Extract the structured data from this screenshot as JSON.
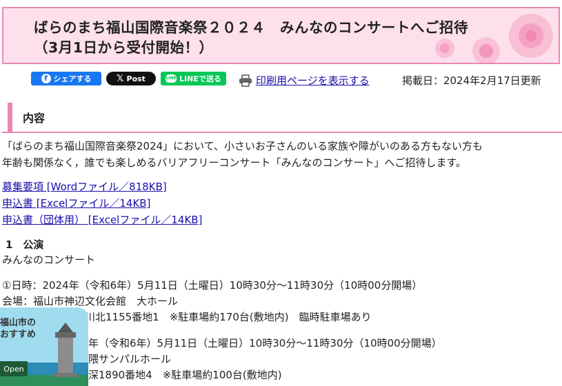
{
  "header": {
    "title_line1": "ばらのまち福山国際音楽祭２０２４　みんなのコンサートへご招待",
    "title_line2": "（3月1日から受付開始！）"
  },
  "share": {
    "facebook": "シェアする",
    "x": "Post",
    "line": "LINEで送る",
    "print_link": "印刷用ページを表示する",
    "posted_date": "掲載日：2024年2月17日更新"
  },
  "content": {
    "section_title": "内容",
    "intro_line1": "「ばらのまち福山国際音楽祭2024」において、小さいお子さんのいる家族や障がいのある方もない方も",
    "intro_line2": "年齢も関係なく，誰でも楽しめるバリアフリーコンサート「みんなのコンサート」へご招待します。",
    "links": [
      "募集要項 [Wordファイル／818KB]",
      "申込書 [Excelファイル／14KB]",
      "申込書（団体用） [Excelファイル／14KB]"
    ],
    "sub_title": "1　公演",
    "concert_name": "みんなのコンサート",
    "event1_date": "①日時：2024年（令和6年）5月11日（土曜日）10時30分～11時30分（10時00分開場）",
    "event1_venue": "会場：福山市神辺文化会館　大ホール",
    "event1_address": "福山市神辺町大字川北1155番地1　※駐車場約170台(敷地内)　臨時駐車場あり",
    "event2_date": "年（令和6年）5月11日（土曜日）10時30分～11時30分（10時00分開場）",
    "event2_venue": "隈サンパルホール",
    "event2_address": "深1890番地4　※駐車場約100台(敷地内)"
  },
  "banner": {
    "title_line1": "福山市の",
    "title_line2": "おすすめ",
    "open_label": "Open"
  }
}
